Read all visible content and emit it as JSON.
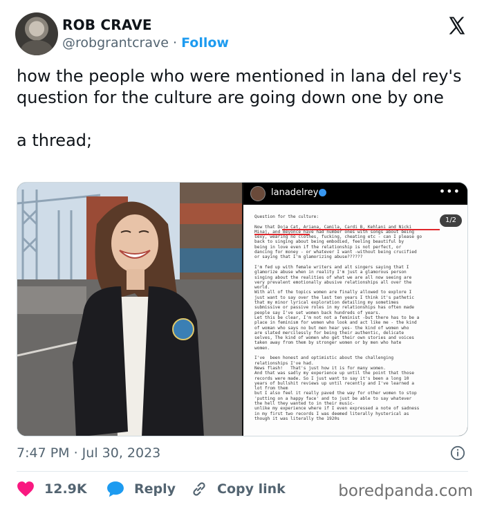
{
  "author": {
    "name": "ROB CRAVE",
    "handle": "@robgrantcrave",
    "separator": "·",
    "follow_label": "Follow"
  },
  "platform_icon": "x-logo-icon",
  "tweet": {
    "text": "how the people who were mentioned in lana del rey's question for the culture are going down one by one\n\na thread;",
    "timestamp": "7:47 PM · Jul 30, 2023"
  },
  "media": {
    "screenshot": {
      "account": "lanadelrey",
      "more": "•••",
      "counter": "1/2",
      "letter": "Question for the culture:\n\nNow that Doja Cat, Ariana, Camila, Cardi B, Kehlani and Nicki\nMinaj, and Beyonce have had number ones with songs about being\nsexy, wearing no clothes, fucking, cheating etc - can I please go\nback to singing about being embodied, feeling beautiful by\nbeing in love even if the relationship is not perfect, or\ndancing for money - or whatever I want -without being crucified\nor saying that I'm glamorizing abuse??????\n\nI'm fed up with female writers and alt singers saying that I\nglamorize abuse when in reality I'm just a glamorous person\nsinging about the realities of what we are all now seeing are\nvery prevalent emotionally abusive relationships all over the\nworld.\nWith all of the topics women are finally allowed to explore I\njust want to say over the last ten years I think it's pathetic\nthat my minor lyrical exploration detailing my sometimes\nsubmissive or passive roles in my relationships has often made\npeople say I've set women back hundreds of years.\nLet this be clear, I'm not not a feminist -but there has to be a\nplace in feminism for women who look and act like me - the kind\nof woman who says no but men hear yes- the kind of women who\nare slated mercilessly for being their authentic, delicate\nselves, The kind of women who get their own stories and voices\ntaken away from them by stronger women or by men who hate\nwomen.\n\nI've  been honest and optimistic about the challenging\nrelationships I've had.\nNews flash!   That's just how it is for many women.\nAnd that was sadly my experience up until the point that those\nrecords were made. So I just want to say it's been a long 10\nyears of bullshit reviews up until recently and I've learned a\nlot from them\nbut I also feel it really paved the way for other women to stop\n'putting on a happy face' and to just be able to say whatever\nthe hell they wanted to in their music-\nunlike my experience where if I even expressed a note of sadness\nin my first two records I was deemed literally hysterical as\nthough it was literally the 1920s"
    }
  },
  "stats": {
    "likes": "12.9K",
    "reply_label": "Reply",
    "copy_label": "Copy link"
  },
  "watermark": "boredpanda.com",
  "colors": {
    "like": "#f91880",
    "reply": "#1d9bf0",
    "follow": "#1d9bf0",
    "muted": "#536471"
  }
}
